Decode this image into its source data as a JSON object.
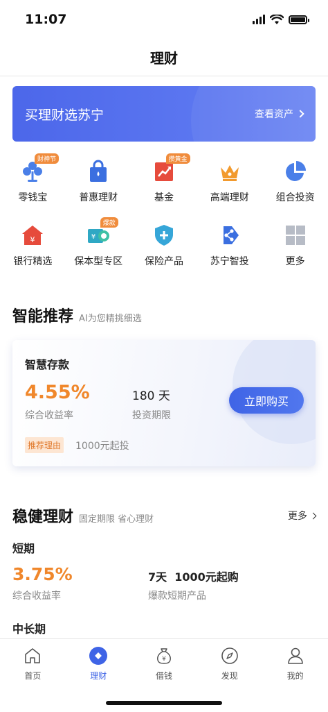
{
  "status": {
    "time": "11:07"
  },
  "nav": {
    "title": "理财"
  },
  "banner": {
    "title": "买理财选苏宁",
    "link": "查看资产"
  },
  "grid": {
    "row1": [
      {
        "label": "零钱宝",
        "badge": "财神节",
        "icon": "clover-icon"
      },
      {
        "label": "普惠理财",
        "badge": "",
        "icon": "bag-icon"
      },
      {
        "label": "基金",
        "badge": "攒黄金",
        "icon": "fund-chart-icon"
      },
      {
        "label": "高端理财",
        "badge": "",
        "icon": "crown-icon"
      },
      {
        "label": "组合投资",
        "badge": "",
        "icon": "pie-chart-icon"
      }
    ],
    "row2": [
      {
        "label": "银行精选",
        "badge": "",
        "icon": "bank-icon"
      },
      {
        "label": "保本型专区",
        "badge": "爆款",
        "icon": "guarantee-icon"
      },
      {
        "label": "保险产品",
        "badge": "",
        "icon": "shield-icon"
      },
      {
        "label": "苏宁智投",
        "badge": "",
        "icon": "share-icon"
      },
      {
        "label": "更多",
        "badge": "",
        "icon": "grid-icon"
      }
    ]
  },
  "smart": {
    "title": "智能推荐",
    "subtitle": "AI为您精挑细选",
    "card": {
      "name": "智慧存款",
      "rate": "4.55%",
      "rate_label": "综合收益率",
      "term": "180 天",
      "term_label": "投资期限",
      "buy": "立即购买",
      "tag": "推荐理由",
      "min": "1000元起投"
    }
  },
  "steady": {
    "title": "稳健理财",
    "subtitle": "固定期限 省心理财",
    "more": "更多",
    "short_title": "短期",
    "short": {
      "rate": "3.75%",
      "rate_label": "综合收益率",
      "info": "7天  1000元起购",
      "info_label": "爆款短期产品"
    },
    "mid_title": "中长期"
  },
  "tabs": [
    {
      "label": "首页",
      "icon": "home-icon",
      "active": false
    },
    {
      "label": "理财",
      "icon": "finance-icon",
      "active": true
    },
    {
      "label": "借钱",
      "icon": "moneybag-icon",
      "active": false
    },
    {
      "label": "发现",
      "icon": "compass-icon",
      "active": false
    },
    {
      "label": "我的",
      "icon": "user-icon",
      "active": false
    }
  ],
  "colors": {
    "accent": "#3f64e6",
    "orange": "#f0872b",
    "badge": "#f08c3c"
  }
}
